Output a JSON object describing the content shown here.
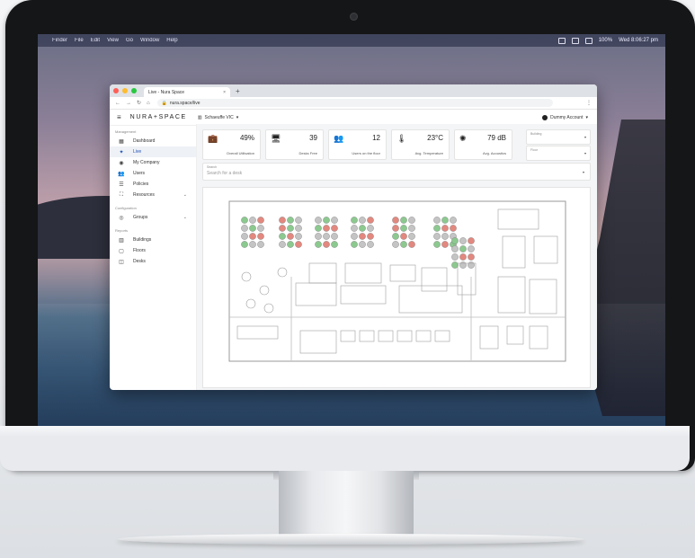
{
  "macos_menubar": {
    "items": [
      "",
      "Finder",
      "File",
      "Edit",
      "View",
      "Go",
      "Window",
      "Help"
    ],
    "battery": "100%",
    "clock": "Wed 8:06:27 pm"
  },
  "browser": {
    "tab_title": "Live - Nura Space",
    "tab_close": "×",
    "new_tab": "+",
    "url": "nura.space/live"
  },
  "app": {
    "logo": "NURA+SPACE",
    "site": "Schaeuffe VIC",
    "account": "Dummy Account"
  },
  "sidebar": {
    "sections": [
      {
        "title": "Management",
        "items": [
          {
            "label": "Dashboard",
            "icon": "▦",
            "active": false
          },
          {
            "label": "Live",
            "icon": "✦",
            "active": true
          },
          {
            "label": "My Company",
            "icon": "◉",
            "active": false
          },
          {
            "label": "Users",
            "icon": "👥",
            "active": false
          },
          {
            "label": "Policies",
            "icon": "☰",
            "active": false
          },
          {
            "label": "Resources",
            "icon": "⛶",
            "active": false,
            "chevron": "⌄"
          }
        ]
      },
      {
        "title": "Configuration",
        "items": [
          {
            "label": "Groups",
            "icon": "◎",
            "active": false,
            "chevron": "⌄"
          }
        ]
      },
      {
        "title": "Reports",
        "items": [
          {
            "label": "Buildings",
            "icon": "▥",
            "active": false
          },
          {
            "label": "Floors",
            "icon": "▢",
            "active": false
          },
          {
            "label": "Desks",
            "icon": "◫",
            "active": false
          }
        ]
      }
    ]
  },
  "stats": [
    {
      "icon": "briefcase-icon",
      "glyph": "💼",
      "value": "49%",
      "label": "Overall Utilisation"
    },
    {
      "icon": "monitor-icon",
      "glyph": "🖥",
      "value": "39",
      "label": "Desks Free"
    },
    {
      "icon": "users-icon",
      "glyph": "👥",
      "value": "12",
      "label": "Users on the floor"
    },
    {
      "icon": "thermometer-icon",
      "glyph": "🌡",
      "value": "23°C",
      "label": "Avg. Temperature"
    },
    {
      "icon": "sound-icon",
      "glyph": "✺",
      "value": "79 dB",
      "label": "Avg. Acoustics"
    }
  ],
  "filters": {
    "building_label": "Building",
    "floor_label": "Floor",
    "caret": "▾"
  },
  "search": {
    "label": "Search",
    "placeholder": "Search for a desk"
  },
  "colors": {
    "occupied": "#e3887f",
    "free": "#8cc98f",
    "offline": "#c4c4c4",
    "accent": "#1d4fb6"
  }
}
